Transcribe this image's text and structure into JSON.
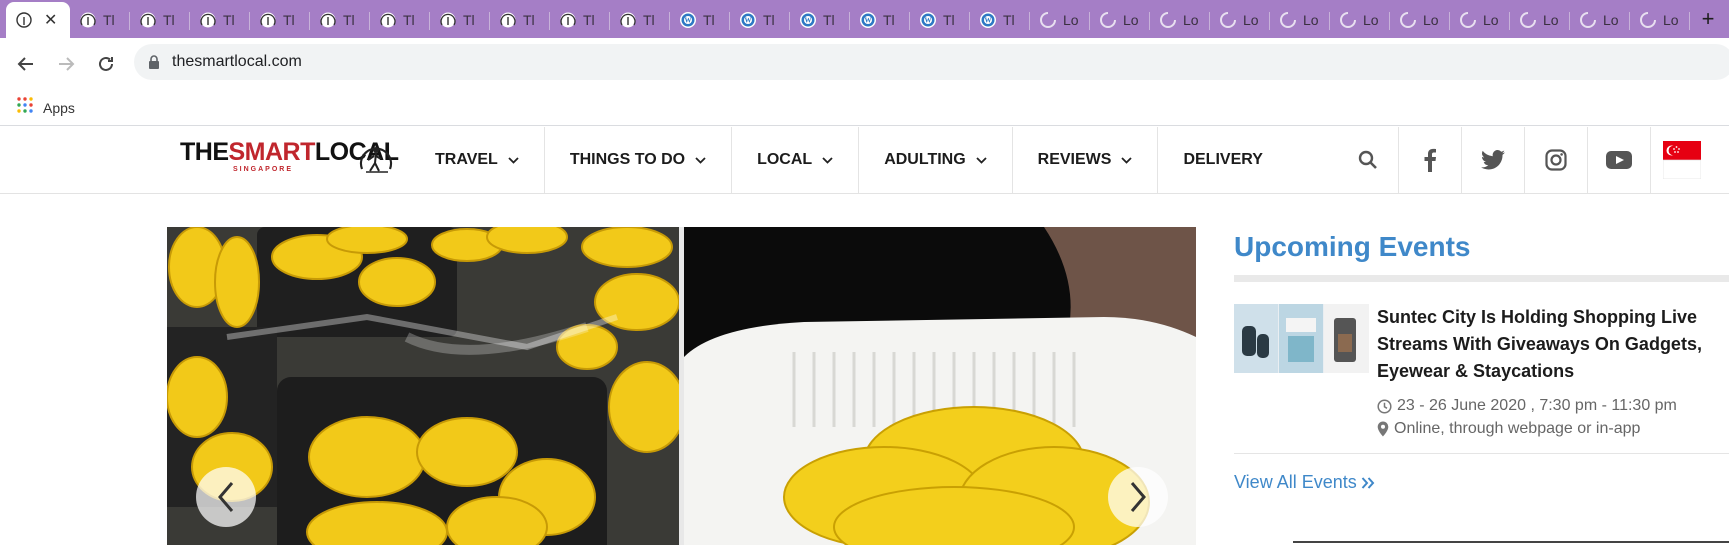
{
  "browser": {
    "active_tab": {
      "title": "",
      "favicon": "tsl-icon"
    },
    "tabs": [
      {
        "title": "Tl",
        "favicon": "tsl-icon"
      },
      {
        "title": "Tl",
        "favicon": "tsl-icon"
      },
      {
        "title": "Tl",
        "favicon": "tsl-icon"
      },
      {
        "title": "Tl",
        "favicon": "tsl-icon"
      },
      {
        "title": "Tl",
        "favicon": "tsl-icon"
      },
      {
        "title": "Tl",
        "favicon": "tsl-icon"
      },
      {
        "title": "Tl",
        "favicon": "tsl-icon"
      },
      {
        "title": "Tl",
        "favicon": "tsl-icon"
      },
      {
        "title": "Tl",
        "favicon": "tsl-icon"
      },
      {
        "title": "Tl",
        "favicon": "tsl-icon"
      },
      {
        "title": "Tl",
        "favicon": "wordpress-icon"
      },
      {
        "title": "Tl",
        "favicon": "wordpress-icon"
      },
      {
        "title": "Tl",
        "favicon": "wordpress-icon"
      },
      {
        "title": "Tl",
        "favicon": "wordpress-icon"
      },
      {
        "title": "Tl",
        "favicon": "wordpress-icon"
      },
      {
        "title": "Tl",
        "favicon": "wordpress-icon"
      },
      {
        "title": "Lo",
        "favicon": "loading-spinner-icon"
      },
      {
        "title": "Lo",
        "favicon": "loading-spinner-icon"
      },
      {
        "title": "Lo",
        "favicon": "loading-spinner-icon"
      },
      {
        "title": "Lo",
        "favicon": "loading-spinner-icon"
      },
      {
        "title": "Lo",
        "favicon": "loading-spinner-icon"
      },
      {
        "title": "Lo",
        "favicon": "loading-spinner-icon"
      },
      {
        "title": "Lo",
        "favicon": "loading-spinner-icon"
      },
      {
        "title": "Lo",
        "favicon": "loading-spinner-icon"
      },
      {
        "title": "Lo",
        "favicon": "loading-spinner-icon"
      },
      {
        "title": "Lo",
        "favicon": "loading-spinner-icon"
      },
      {
        "title": "Lo",
        "favicon": "loading-spinner-icon"
      }
    ],
    "address": "thesmartlocal.com",
    "bookmarks": {
      "apps_label": "Apps"
    },
    "colors": {
      "tabstrip": "#a57ec6"
    }
  },
  "site": {
    "logo": {
      "part1": "THE",
      "part2": "SMART",
      "part3": "LOCAL",
      "tagline": "SINGAPORE"
    },
    "nav": [
      {
        "label": "TRAVEL",
        "has_dropdown": true
      },
      {
        "label": "THINGS TO DO",
        "has_dropdown": true
      },
      {
        "label": "LOCAL",
        "has_dropdown": true
      },
      {
        "label": "ADULTING",
        "has_dropdown": true
      },
      {
        "label": "REVIEWS",
        "has_dropdown": true
      },
      {
        "label": "DELIVERY",
        "has_dropdown": false
      }
    ],
    "social_icons": [
      "search-icon",
      "facebook-icon",
      "twitter-icon",
      "instagram-icon",
      "youtube-icon",
      "singapore-flag-icon"
    ]
  },
  "sidebar": {
    "heading": "Upcoming Events",
    "event": {
      "title": "Suntec City Is Holding Shopping Live Streams With Giveaways On Gadgets, Eyewear & Staycations",
      "date": "23 - 26 June 2020 , 7:30 pm - 11:30 pm",
      "location": "Online, through webpage or in-app"
    },
    "view_all": "View All Events",
    "accent": "#3f88c9"
  }
}
